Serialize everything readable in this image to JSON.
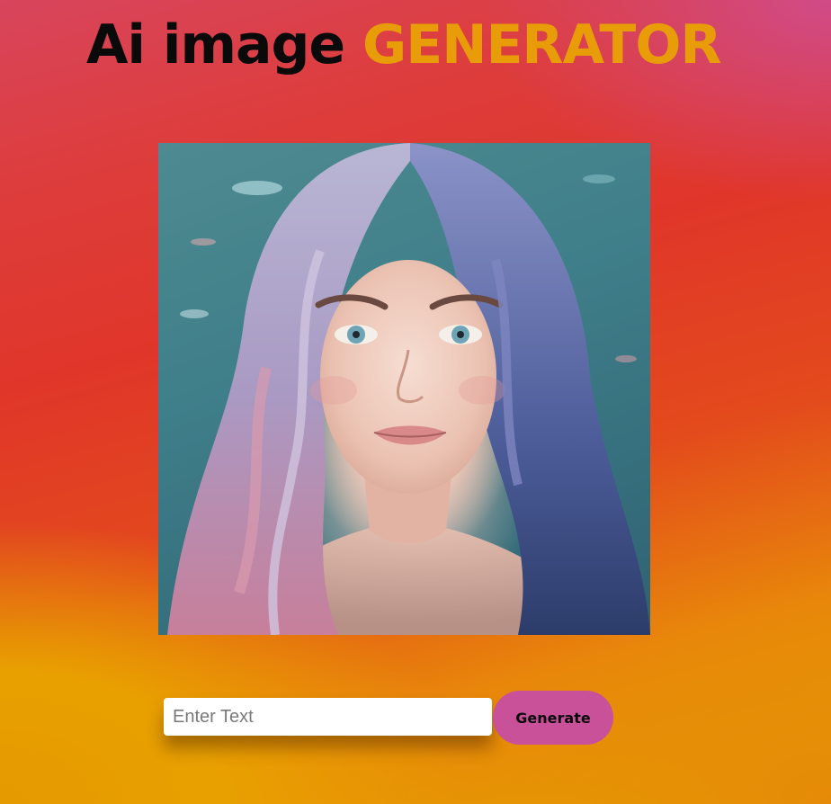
{
  "header": {
    "title_part1": "Ai image",
    "title_part2": "GENERATOR"
  },
  "image": {
    "alt": "AI generated portrait of a young woman with long wavy lavender hair in water"
  },
  "form": {
    "input_placeholder": "Enter Text",
    "input_value": "",
    "generate_label": "Generate"
  },
  "colors": {
    "accent_orange": "#e89c08",
    "button_pink": "#c9519a",
    "title_dark": "#0a0a0a"
  }
}
